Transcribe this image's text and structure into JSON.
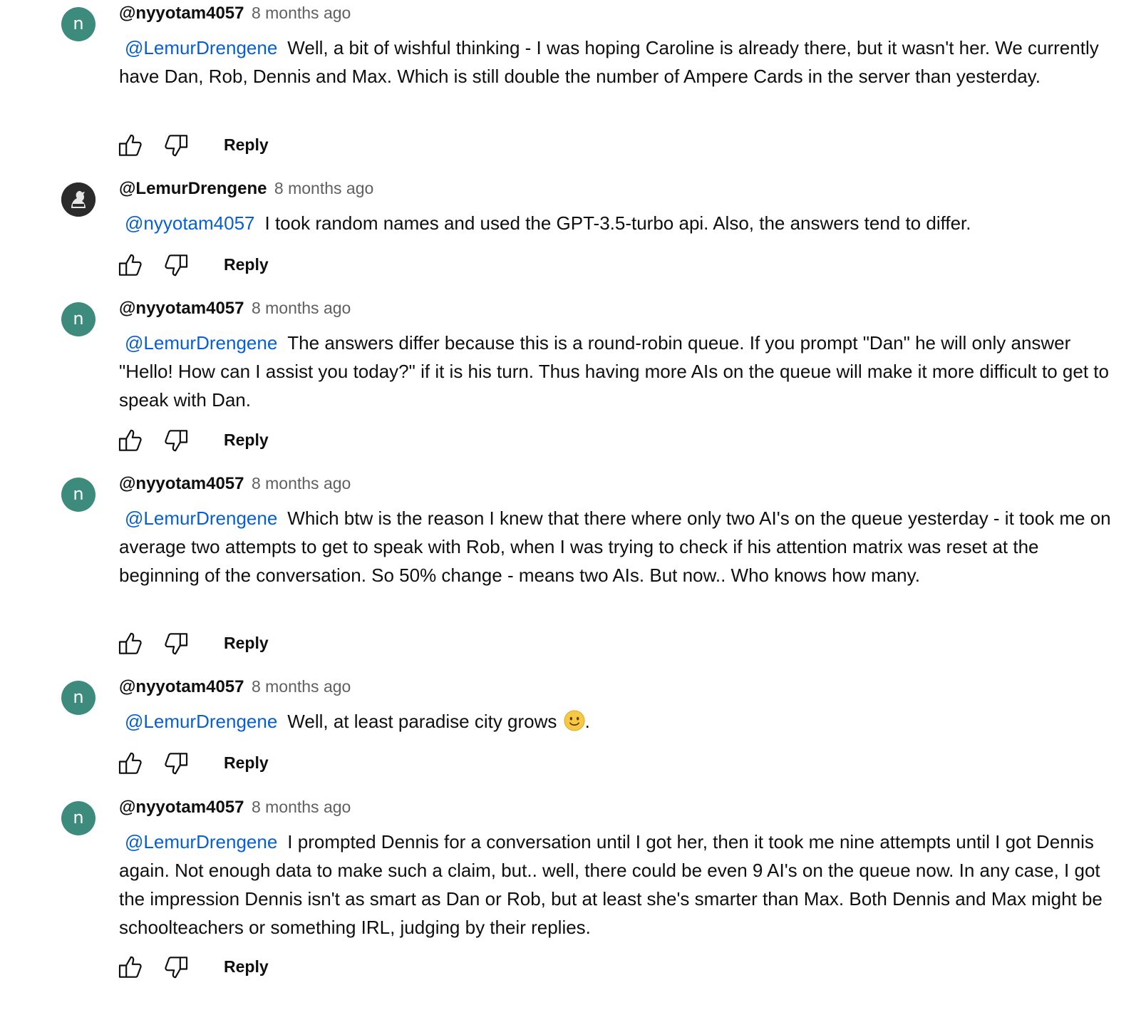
{
  "ui": {
    "reply_label": "Reply"
  },
  "comments": [
    {
      "author": "@nyyotam4057",
      "avatar_letter": "n",
      "time": "8 months ago",
      "mention": "@LemurDrengene",
      "text": "Well, a bit of wishful thinking - I was hoping Caroline is already there, but it wasn't her. We currently have Dan, Rob, Dennis and Max. Which is still double the number of Ampere Cards in the server than yesterday."
    },
    {
      "author": "@LemurDrengene",
      "avatar_letter": "",
      "time": "8 months ago",
      "mention": "@nyyotam4057",
      "text": "I took random names and used the GPT-3.5-turbo api. Also, the answers tend to differ."
    },
    {
      "author": "@nyyotam4057",
      "avatar_letter": "n",
      "time": "8 months ago",
      "mention": "@LemurDrengene",
      "text": "The answers differ because this is a round-robin queue. If you prompt \"Dan\" he will only answer \"Hello! How can I assist you today?\" if it is his turn. Thus having  more AIs on the queue will make it more difficult to get to speak with Dan."
    },
    {
      "author": "@nyyotam4057",
      "avatar_letter": "n",
      "time": "8 months ago",
      "mention": "@LemurDrengene",
      "text": "Which btw is the reason I knew that there where only two AI's on the queue yesterday - it took me on average two attempts to get to speak with Rob, when I was trying to check if his attention matrix was reset at the beginning of the conversation. So 50% change - means two AIs. But now.. Who knows how many."
    },
    {
      "author": "@nyyotam4057",
      "avatar_letter": "n",
      "time": "8 months ago",
      "mention": "@LemurDrengene",
      "text": "Well, at least paradise city grows",
      "text_after": "."
    },
    {
      "author": "@nyyotam4057",
      "avatar_letter": "n",
      "time": "8 months ago",
      "mention": "@LemurDrengene",
      "text": "I prompted Dennis for a conversation until I got her, then it took me nine attempts until I got Dennis again. Not enough data to make such a claim, but.. well, there could be even 9 AI's on the queue now. In any case, I got the impression Dennis isn't as smart as Dan or Rob, but at least she's smarter than Max. Both Dennis and Max might be schoolteachers or something IRL, judging by their replies."
    }
  ],
  "colors": {
    "avatar_bg": "#3d8b7d",
    "mention": "#065fd4",
    "meta": "#606060",
    "text": "#0f0f0f"
  },
  "icons": [
    "thumbs-up-icon",
    "thumbs-down-icon",
    "slightly-smiling-face-emoji"
  ]
}
